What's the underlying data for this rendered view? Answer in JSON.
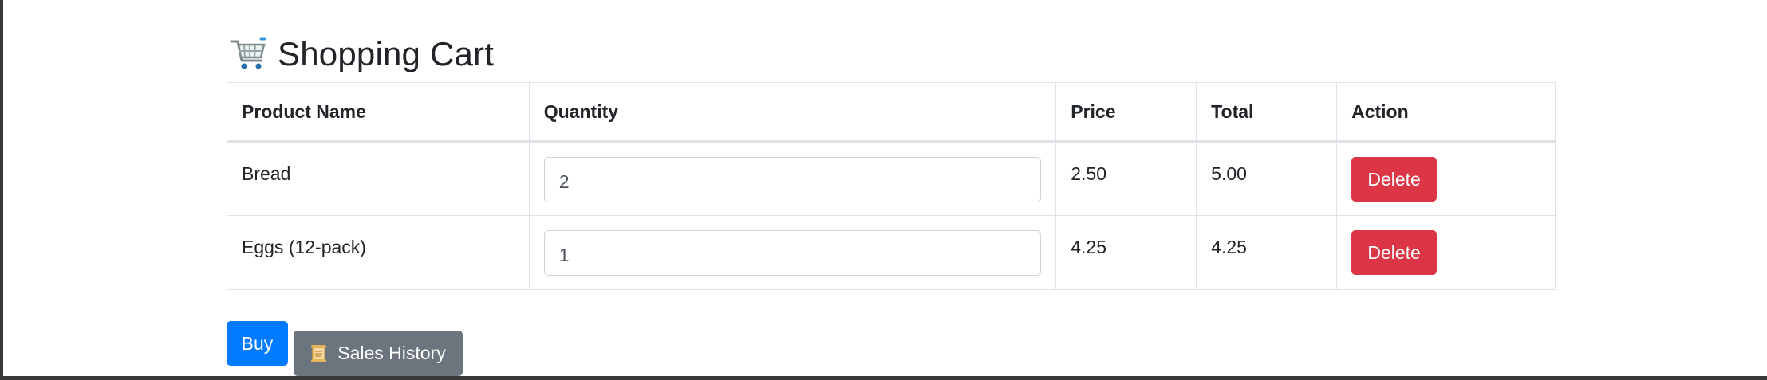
{
  "page": {
    "title": "Shopping Cart",
    "title_icon": "shopping-cart-icon"
  },
  "table": {
    "headers": {
      "product": "Product Name",
      "quantity": "Quantity",
      "price": "Price",
      "total": "Total",
      "action": "Action"
    },
    "rows": [
      {
        "product": "Bread",
        "quantity": "2",
        "price": "2.50",
        "total": "5.00",
        "action": "Delete"
      },
      {
        "product": "Eggs (12-pack)",
        "quantity": "1",
        "price": "4.25",
        "total": "4.25",
        "action": "Delete"
      }
    ]
  },
  "actions": {
    "buy_label": "Buy",
    "history_label": "Sales History",
    "history_icon": "scroll-icon"
  },
  "colors": {
    "delete": "#dc3545",
    "buy": "#007bff",
    "history": "#6c757d"
  }
}
